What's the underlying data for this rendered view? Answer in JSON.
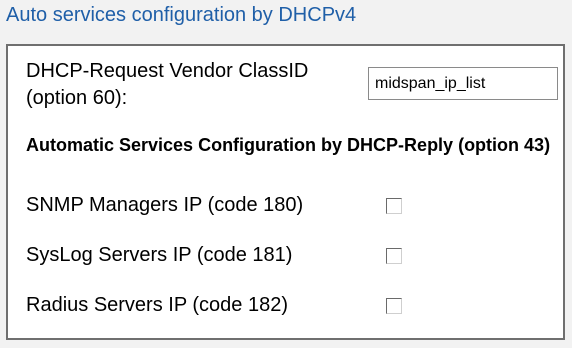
{
  "header": {
    "title": "Auto services configuration by DHCPv4"
  },
  "vendor": {
    "label": "DHCP-Request Vendor ClassID (option 60):",
    "value": "midspan_ip_list"
  },
  "section": {
    "heading": "Automatic Services Configuration by DHCP-Reply (option 43)"
  },
  "options": [
    {
      "label": "SNMP Managers IP (code 180)",
      "checked": false
    },
    {
      "label": "SysLog Servers IP (code 181)",
      "checked": false
    },
    {
      "label": "Radius Servers IP (code 182)",
      "checked": false
    }
  ],
  "colors": {
    "title": "#1f5fa8",
    "border": "#6f6f6f",
    "background": "#f2f2f2"
  }
}
